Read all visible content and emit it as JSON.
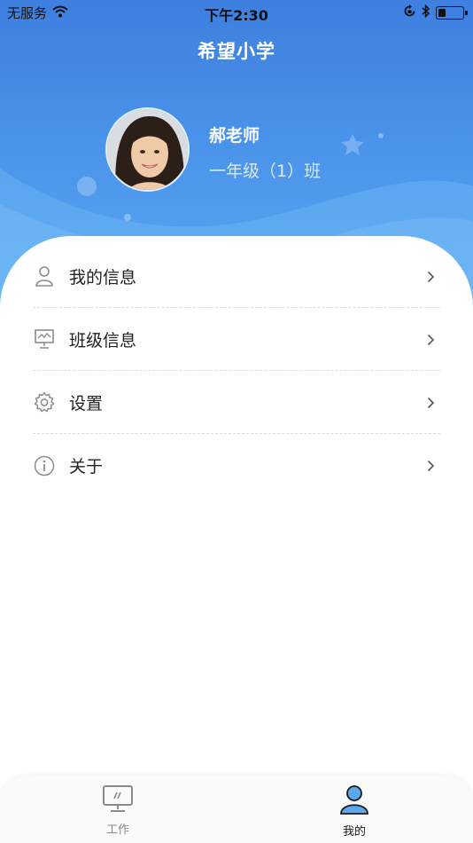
{
  "status_bar": {
    "carrier": "无服务",
    "time": "下午2:30",
    "battery_level": 0.3
  },
  "header": {
    "school_name": "希望小学"
  },
  "profile": {
    "name": "郝老师",
    "class": "一年级（1）班"
  },
  "menu": {
    "items": [
      {
        "label": "我的信息",
        "icon": "user-icon"
      },
      {
        "label": "班级信息",
        "icon": "presentation-board-icon"
      },
      {
        "label": "设置",
        "icon": "gear-icon"
      },
      {
        "label": "关于",
        "icon": "info-icon"
      }
    ]
  },
  "tabbar": {
    "tabs": [
      {
        "label": "工作",
        "icon": "monitor-icon",
        "active": false
      },
      {
        "label": "我的",
        "icon": "person-icon",
        "active": true
      }
    ]
  },
  "colors": {
    "header_top": "#3e7fe0",
    "header_bottom": "#5aaaf2",
    "tab_active": "#1a1a1a",
    "tab_inactive": "#8a8a8a",
    "icon_gray": "#8c8c8c"
  }
}
